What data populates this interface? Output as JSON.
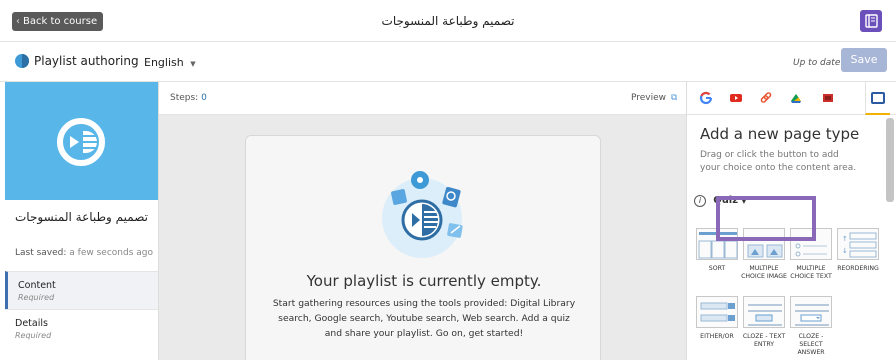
{
  "topbar": {
    "back_label": "Back to course",
    "course_title": "تصميم وطباعة المنسوجات"
  },
  "subbar": {
    "app_label": "Playlist authoring",
    "language": "English",
    "status": "Up to date",
    "save_label": "Save"
  },
  "sidebar": {
    "title": "تصميم وطباعة المنسوجات",
    "saved_prefix": "Last saved:",
    "saved_when": "a few seconds ago",
    "items": [
      {
        "label": "Content",
        "sub": "Required"
      },
      {
        "label": "Details",
        "sub": "Required"
      }
    ]
  },
  "center": {
    "steps_label": "Steps:",
    "steps_count": "0",
    "preview_label": "Preview",
    "empty_title": "Your playlist is currently empty.",
    "empty_desc": "Start gathering resources using the tools provided: Digital Library search, Google search, Youtube search, Web search. Add a quiz and share your playlist. Go on, get started!"
  },
  "right": {
    "tabs": [
      "google-icon",
      "youtube-icon",
      "link-icon",
      "drive-icon",
      "library-icon",
      "page-types-icon"
    ],
    "title": "Add a new page type",
    "desc": "Drag or click the button to add your choice onto the content area.",
    "section_label": "Quiz",
    "qtypes": [
      {
        "cap": "SORT"
      },
      {
        "cap": "MULTIPLE CHOICE IMAGE"
      },
      {
        "cap": "MULTIPLE CHOICE TEXT"
      },
      {
        "cap": "REORDERING"
      },
      {
        "cap": "EITHER/OR"
      },
      {
        "cap": "CLOZE - TEXT ENTRY"
      },
      {
        "cap": "CLOZE - SELECT ANSWER"
      }
    ]
  },
  "colors": {
    "accent_purple": "#6b4fbb",
    "hero_blue": "#59b6e8",
    "save_disabled": "#a7b6d6",
    "highlight": "#8a68b8"
  }
}
